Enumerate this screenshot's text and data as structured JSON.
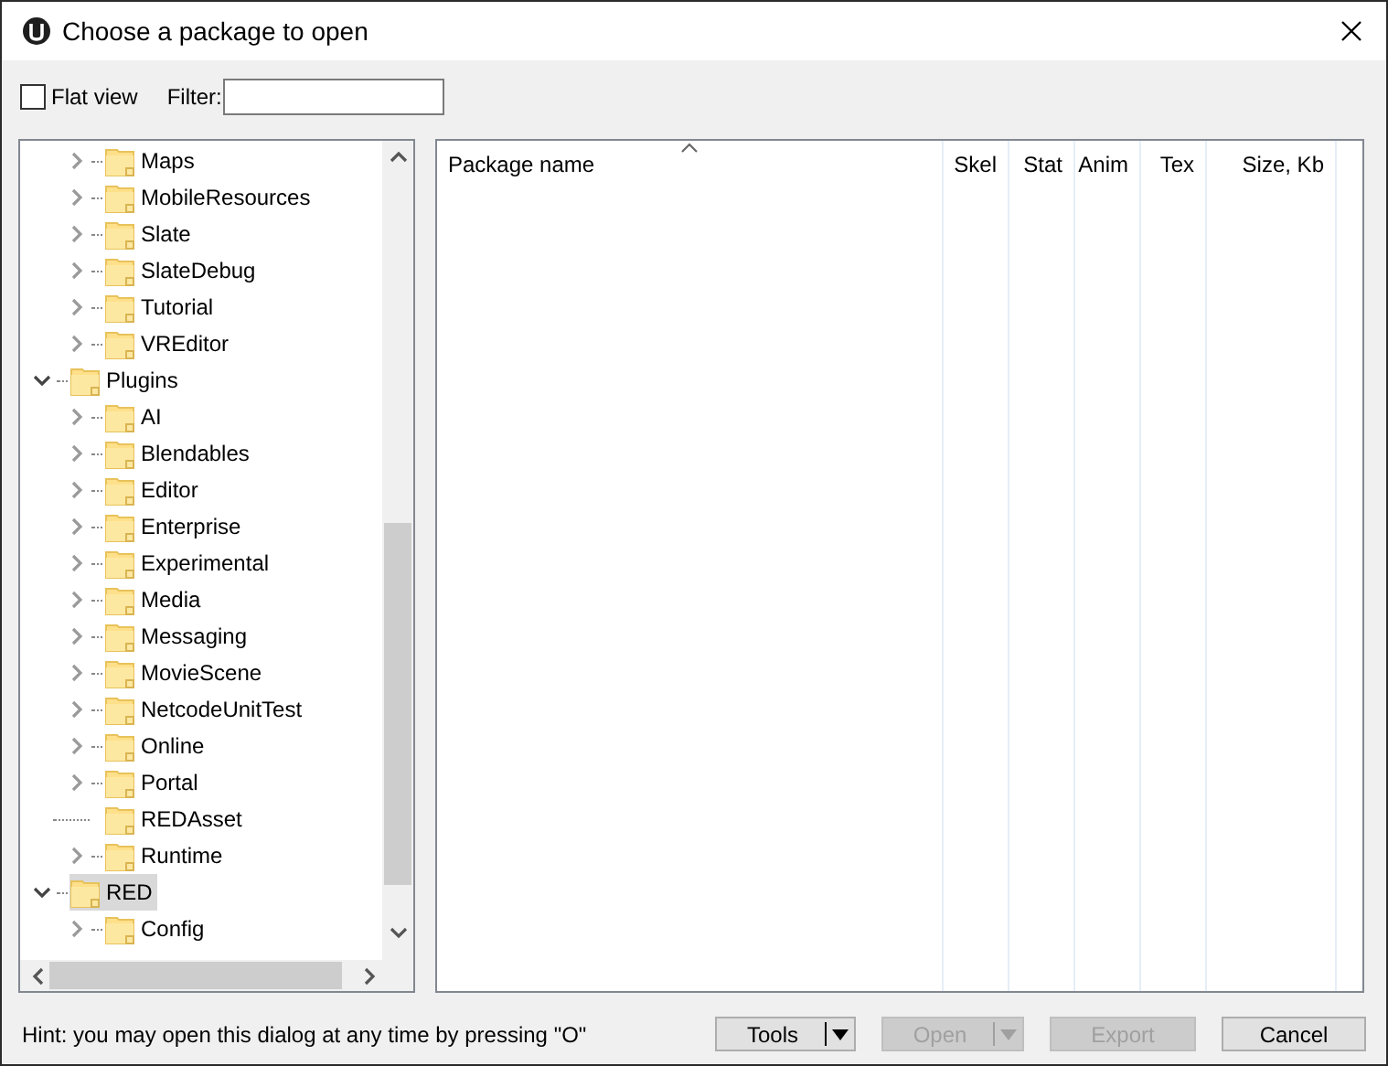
{
  "window": {
    "title": "Choose a package to open"
  },
  "toolbar": {
    "flat_view": {
      "label": "Flat view",
      "checked": false
    },
    "filter": {
      "label": "Filter:"
    }
  },
  "tree": {
    "continued_items": [
      {
        "label": "Maps",
        "expandable": true
      },
      {
        "label": "MobileResources",
        "expandable": true
      },
      {
        "label": "Slate",
        "expandable": true
      },
      {
        "label": "SlateDebug",
        "expandable": true
      },
      {
        "label": "Tutorial",
        "expandable": true
      },
      {
        "label": "VREditor",
        "expandable": true
      }
    ],
    "items": [
      {
        "label": "Plugins",
        "expandable": true,
        "expanded": true,
        "selected": false,
        "children": [
          {
            "label": "AI",
            "expandable": true
          },
          {
            "label": "Blendables",
            "expandable": true
          },
          {
            "label": "Editor",
            "expandable": true
          },
          {
            "label": "Enterprise",
            "expandable": true
          },
          {
            "label": "Experimental",
            "expandable": true
          },
          {
            "label": "Media",
            "expandable": true
          },
          {
            "label": "Messaging",
            "expandable": true
          },
          {
            "label": "MovieScene",
            "expandable": true
          },
          {
            "label": "NetcodeUnitTest",
            "expandable": true
          },
          {
            "label": "Online",
            "expandable": true
          },
          {
            "label": "Portal",
            "expandable": true
          },
          {
            "label": "REDAsset",
            "expandable": false
          },
          {
            "label": "Runtime",
            "expandable": true
          }
        ]
      },
      {
        "label": "RED",
        "expandable": true,
        "expanded": true,
        "selected": true,
        "children": [
          {
            "label": "Config",
            "expandable": true
          }
        ]
      }
    ]
  },
  "package_list": {
    "columns": [
      {
        "label": "Package name",
        "sorted": true
      },
      {
        "label": "Skel",
        "sorted": false
      },
      {
        "label": "Stat",
        "sorted": false
      },
      {
        "label": "Anim",
        "sorted": false
      },
      {
        "label": "Tex",
        "sorted": false
      },
      {
        "label": "Size, Kb",
        "sorted": false
      }
    ]
  },
  "footer": {
    "hint": "Hint: you may open this dialog at any time by pressing \"O\"",
    "buttons": [
      {
        "label": "Tools",
        "kind": "split",
        "disabled": false
      },
      {
        "label": "Open",
        "kind": "split",
        "disabled": true
      },
      {
        "label": "Export",
        "kind": "plain",
        "disabled": true
      },
      {
        "label": "Cancel",
        "kind": "plain",
        "disabled": false
      }
    ]
  }
}
